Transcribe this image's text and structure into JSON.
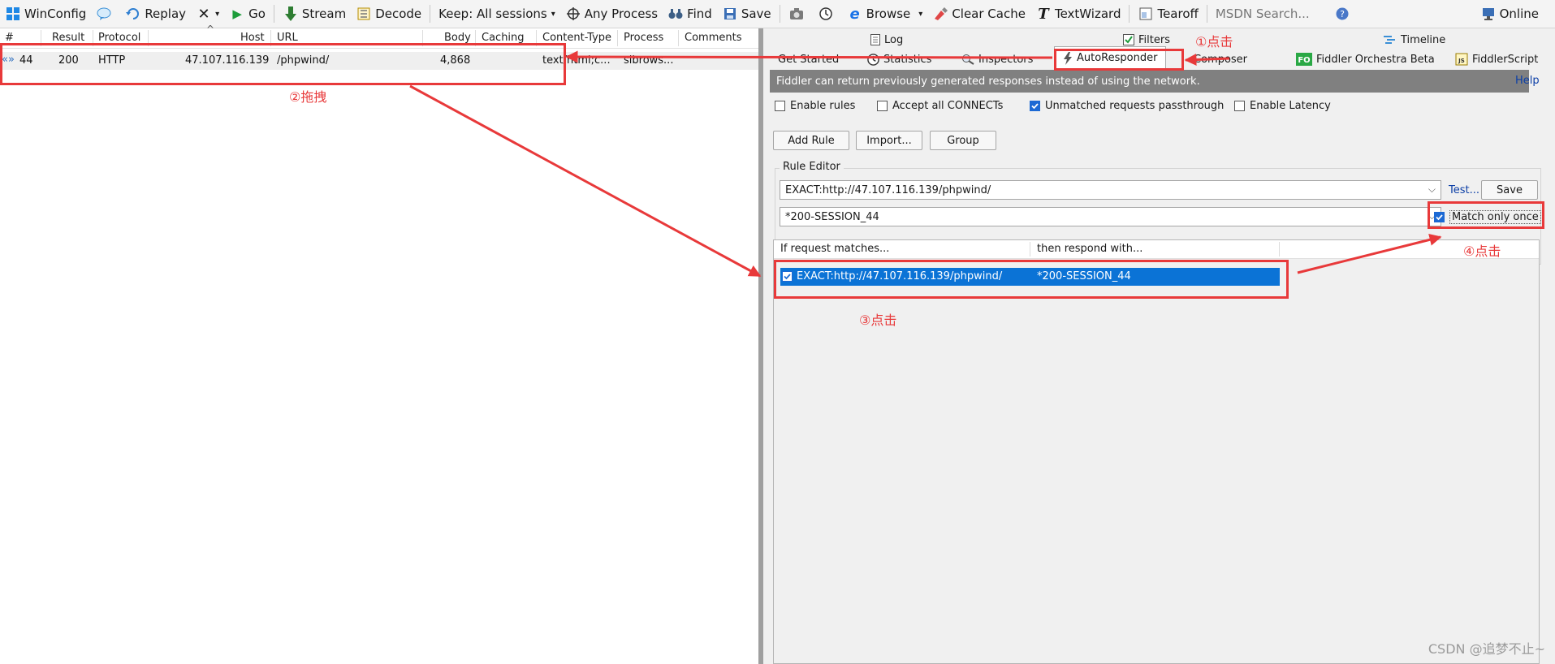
{
  "toolbar": {
    "items": [
      {
        "label": "WinConfig",
        "icon": "windows-logo-icon"
      },
      {
        "label": "Replay",
        "icon": "replay-icon"
      },
      {
        "label": "",
        "icon": "remove-icon"
      },
      {
        "label": "Go",
        "icon": "play-icon"
      },
      {
        "label": "Stream",
        "icon": "stream-icon"
      },
      {
        "label": "Decode",
        "icon": "decode-icon"
      },
      {
        "label": "Keep: All sessions",
        "icon": "dropdown-icon"
      },
      {
        "label": "Any Process",
        "icon": "crosshair-icon"
      },
      {
        "label": "Find",
        "icon": "binoculars-icon"
      },
      {
        "label": "Save",
        "icon": "save-icon"
      },
      {
        "label": "",
        "icon": "camera-icon"
      },
      {
        "label": "",
        "icon": "timer-icon"
      },
      {
        "label": "Browse",
        "icon": "browser-icon"
      },
      {
        "label": "Clear Cache",
        "icon": "clear-cache-icon"
      },
      {
        "label": "TextWizard",
        "icon": "textwizard-icon"
      },
      {
        "label": "Tearoff",
        "icon": "tearoff-icon"
      }
    ],
    "search_placeholder": "MSDN Search...",
    "online_label": "Online"
  },
  "sessions": {
    "columns": [
      "#",
      "Result",
      "Protocol",
      "Host",
      "URL",
      "Body",
      "Caching",
      "Content-Type",
      "Process",
      "Comments"
    ],
    "rows": [
      {
        "id": "44",
        "result": "200",
        "protocol": "HTTP",
        "host": "47.107.116.139",
        "url": "/phpwind/",
        "body": "4,868",
        "caching": "",
        "content_type": "text/html;c...",
        "process": "sibrows...",
        "comments": ""
      }
    ]
  },
  "tabs": {
    "row1": [
      "Log",
      "Filters",
      "Timeline"
    ],
    "row2": [
      "Get Started",
      "Statistics",
      "Inspectors",
      "AutoResponder",
      "Composer",
      "Fiddler Orchestra Beta",
      "FiddlerScript"
    ],
    "active": "AutoResponder"
  },
  "autoresponder": {
    "banner": "Fiddler can return previously generated responses instead of using the network.",
    "help": "Help",
    "options": [
      {
        "label": "Enable rules",
        "checked": false
      },
      {
        "label": "Accept all CONNECTs",
        "checked": false
      },
      {
        "label": "Unmatched requests passthrough",
        "checked": true
      },
      {
        "label": "Enable Latency",
        "checked": false
      }
    ],
    "buttons": [
      "Add Rule",
      "Import...",
      "Group"
    ],
    "rule_editor_label": "Rule Editor",
    "match_value": "EXACT:http://47.107.116.139/phpwind/",
    "respond_value": "*200-SESSION_44",
    "test_label": "Test...",
    "save_label": "Save",
    "match_once_label": "Match only once",
    "match_once_checked": true,
    "rules_columns": [
      "If request matches...",
      "then respond with..."
    ],
    "rules": [
      {
        "checked": true,
        "match": "EXACT:http://47.107.116.139/phpwind/",
        "respond": "*200-SESSION_44"
      }
    ]
  },
  "annotations": {
    "step1": "①点击",
    "step2": "②拖拽",
    "step3": "③点击",
    "step4": "④点击",
    "color": "#e8393a"
  },
  "watermark": "CSDN @追梦不止~"
}
